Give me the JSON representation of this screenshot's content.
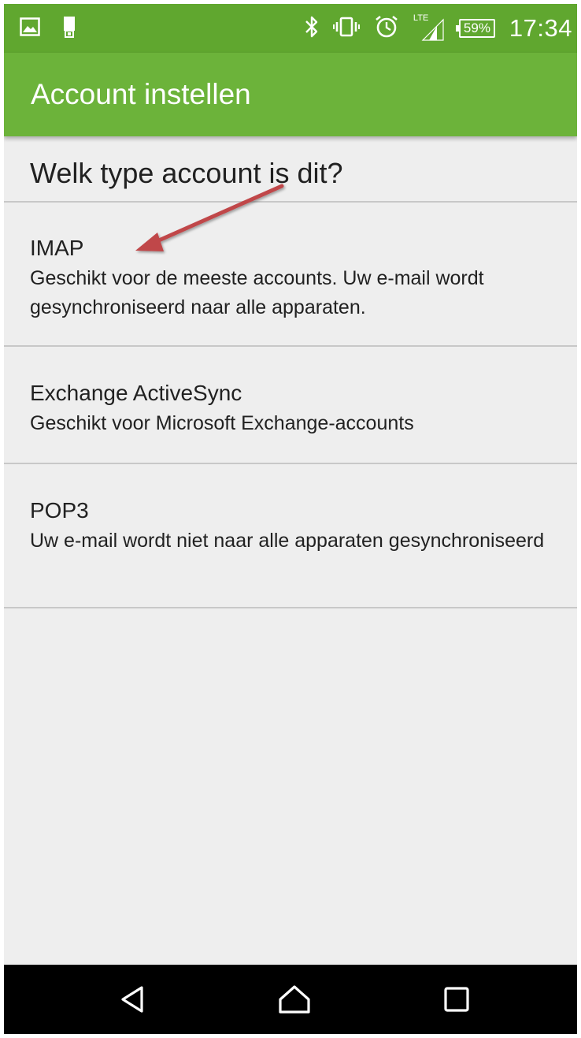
{
  "status_bar": {
    "time": "17:34",
    "battery": "59%",
    "network": "LTE",
    "icons": [
      "image-icon",
      "sim-icon",
      "bluetooth-icon",
      "vibrate-icon",
      "alarm-icon",
      "signal-icon",
      "battery-icon"
    ]
  },
  "app_bar": {
    "title": "Account instellen"
  },
  "question": "Welk type account is dit?",
  "options": [
    {
      "title": "IMAP",
      "description": "Geschikt voor de meeste accounts. Uw e-mail wordt gesynchroniseerd naar alle apparaten."
    },
    {
      "title": "Exchange ActiveSync",
      "description": "Geschikt voor Microsoft Exchange-accounts"
    },
    {
      "title": "POP3",
      "description": "Uw e-mail wordt niet naar alle apparaten gesynchroniseerd"
    }
  ],
  "annotation": {
    "type": "arrow",
    "points_to": "IMAP",
    "color": "#c0464a"
  },
  "nav_bar": {
    "buttons": [
      "back-icon",
      "home-icon",
      "recents-icon"
    ]
  },
  "colors": {
    "status_bar": "#60a72f",
    "app_bar": "#6cb33a",
    "background": "#eeeeee",
    "divider": "#c8c8c8"
  }
}
